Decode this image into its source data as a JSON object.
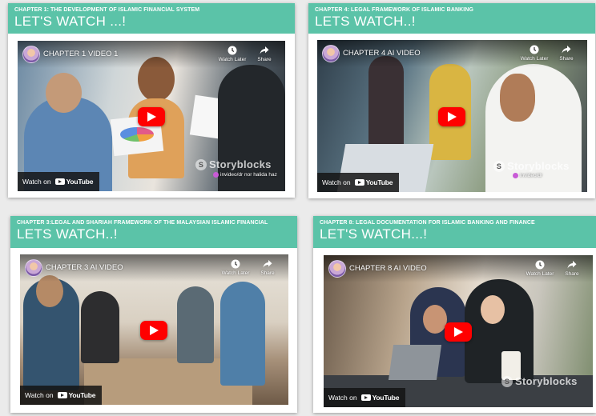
{
  "common": {
    "watch_later": "Watch Later",
    "share": "Share",
    "watch_on": "Watch on",
    "youtube": "YouTube",
    "storyblocks": "Storyblocks",
    "colors": {
      "header": "#5bc3a8",
      "play": "#ff0000"
    }
  },
  "cards": [
    {
      "chapter": "CHAPTER 1: THE DEVELOPMENT OF ISLAMIC FINANCIAL SYSTEM",
      "heading": "LET'S WATCH ...!",
      "video_title": "CHAPTER 1 VIDEO 1",
      "credit": "invideo/dr nor halida haz"
    },
    {
      "chapter": "CHAPTER 4: LEGAL FRAMEWORK OF ISLAMIC BANKING",
      "heading": "LETS WATCH..!",
      "video_title": "CHAPTER 4 AI VIDEO",
      "credit": "invideo/dr"
    },
    {
      "chapter": "CHAPTER 3:LEGAL AND SHARIAH FRAMEWORK OF THE MALAYSIAN ISLAMIC FINANCIAL",
      "heading": "LETS WATCH..!",
      "video_title": "CHAPTER 3 AI VIDEO",
      "credit": ""
    },
    {
      "chapter": "CHAPTER 8: LEGAL DOCUMENTATION FOR ISLAMIC BANKING AND FINANCE",
      "heading": "LET'S WATCH...!",
      "video_title": "CHAPTER 8 AI VIDEO",
      "credit": ""
    }
  ]
}
